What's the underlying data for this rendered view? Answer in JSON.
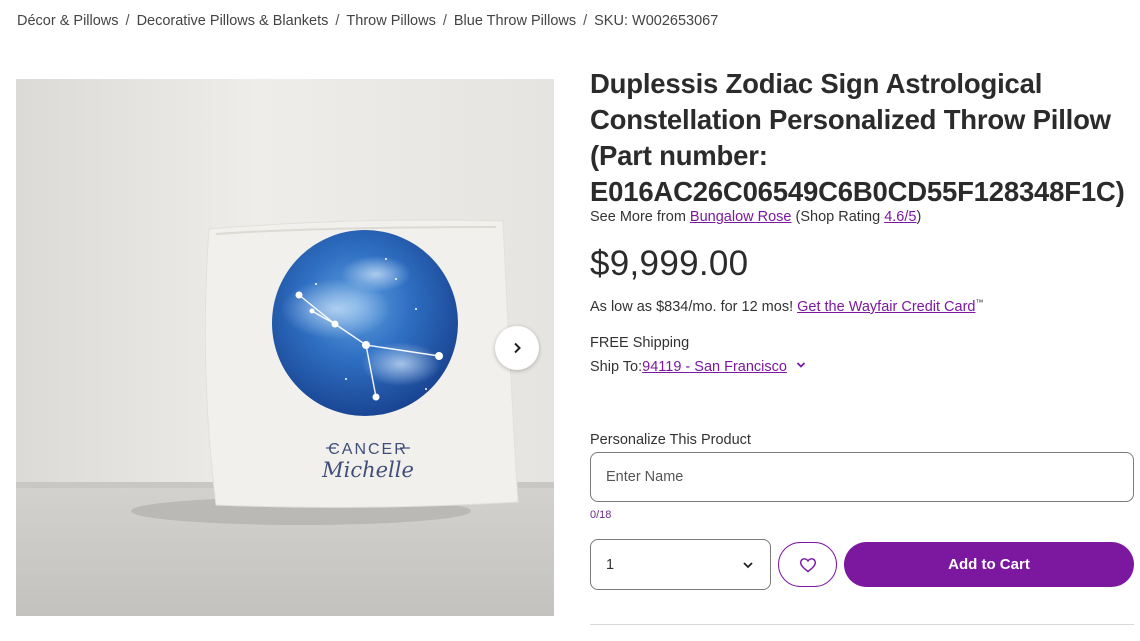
{
  "breadcrumbs": [
    "Décor & Pillows",
    "Decorative Pillows & Blankets",
    "Throw Pillows",
    "Blue Throw Pillows"
  ],
  "sku": "SKU: W002653067",
  "product": {
    "image": {
      "sign_text": "CANCER",
      "name_text": "Michelle"
    },
    "title": "Duplessis Zodiac Sign Astrological Constellation Personalized Throw Pillow (Part number: E016AC26C06549C6B0CD55F128348F1C)",
    "see_more_prefix": "See More from ",
    "brand": "Bungalow Rose",
    "rating_prefix": " (Shop Rating ",
    "rating": "4.6/5",
    "rating_suffix": ")",
    "price": "$9,999.00"
  },
  "finance": {
    "text": "As low as $834/mo. for 12 mos! ",
    "link": "Get the Wayfair Credit Card",
    "mark": "™"
  },
  "shipping": {
    "free": "FREE Shipping",
    "ship_to_label": "Ship To: ",
    "location": "94119 - San Francisco"
  },
  "personalize": {
    "label": "Personalize This Product",
    "placeholder": "Enter Name",
    "counter": "0/18"
  },
  "purchase": {
    "quantity": "1",
    "add_to_cart": "Add to Cart"
  },
  "icons": {
    "next": "chevron-right-icon",
    "ship_dropdown": "chevron-down-icon",
    "qty_dropdown": "chevron-down-icon",
    "favorite": "heart-icon"
  },
  "colors": {
    "accent": "#7b189f",
    "text": "#2b2b2b"
  }
}
